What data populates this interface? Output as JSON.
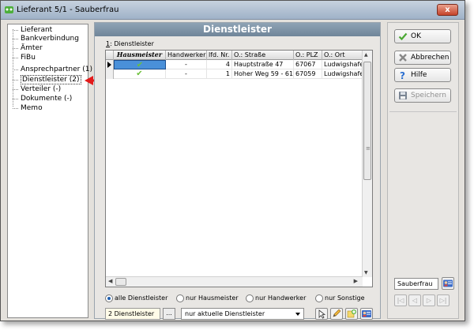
{
  "window": {
    "title": "Lieferant 5/1 - Sauberfrau",
    "close_label": "x"
  },
  "nav_tree": {
    "items": [
      {
        "label": "Lieferant"
      },
      {
        "label": "Bankverbindung"
      },
      {
        "label": "Ämter"
      },
      {
        "label": "FiBu"
      },
      {
        "label": "Ansprechpartner (1)"
      },
      {
        "label": "Dienstleister (2)",
        "selected": true
      },
      {
        "label": "Verteiler (-)"
      },
      {
        "label": "Dokumente (-)"
      },
      {
        "label": "Memo"
      }
    ]
  },
  "panel": {
    "title": "Dienstleister",
    "grid_caption_key": "1",
    "grid_caption_rest": ": Dienstleister"
  },
  "grid": {
    "columns": [
      "Hausmeister",
      "Handwerker",
      "lfd. Nr.",
      "O.: Straße",
      "O.: PLZ",
      "O.: Ort"
    ],
    "rows": [
      {
        "hausmeister": "✔",
        "handwerker": "-",
        "lfd_nr": "4",
        "strasse": "Hauptstraße 47",
        "plz": "67067",
        "ort": "Ludwigshafe"
      },
      {
        "hausmeister": "✔",
        "handwerker": "-",
        "lfd_nr": "1",
        "strasse": "Hoher Weg 59 - 61",
        "plz": "67059",
        "ort": "Ludwigshafe"
      }
    ]
  },
  "filters": {
    "options": [
      "alle Dienstleister",
      "nur Hausmeister",
      "nur Handwerker",
      "nur Sonstige"
    ],
    "selected": "alle Dienstleister"
  },
  "footer": {
    "count_label": "2 Dienstleister",
    "dots_label": "...",
    "select_value": "nur aktuelle Dienstleister"
  },
  "actions": {
    "ok": "OK",
    "cancel": "Abbrechen",
    "help": "Hilfe",
    "save": "Speichern"
  },
  "contact": {
    "name": "Sauberfrau"
  },
  "colors": {
    "accent": "#4a90d9",
    "check": "#6cc03b",
    "header": "#7a8ea2",
    "arrow": "#e31b1b"
  }
}
